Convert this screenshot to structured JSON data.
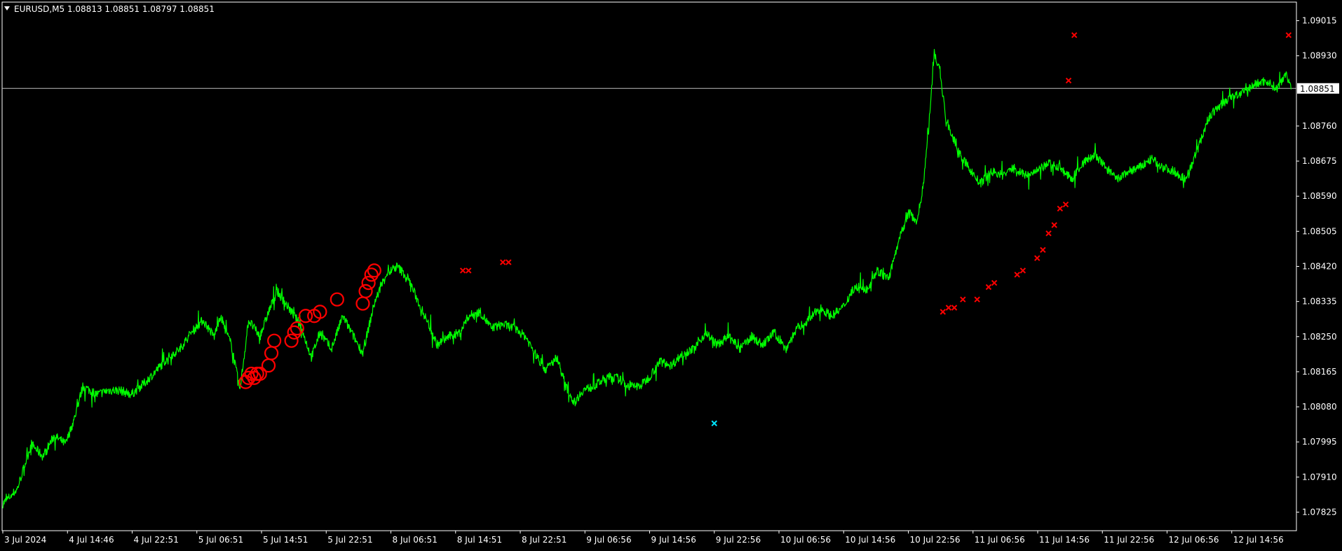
{
  "window": {
    "title": "EURUSD,M5  1.08813 1.08851 1.08797 1.08851",
    "menu_icon": "triangle-down-icon"
  },
  "colors": {
    "background": "#000000",
    "frame": "#ffffff",
    "price_line": "#00ff00",
    "marker_red": "#ff0000",
    "marker_cyan": "#00e5ff",
    "current_price_line": "#bebebe",
    "label_bg": "#ffffff",
    "label_text": "#000000"
  },
  "chart_data": {
    "type": "line",
    "symbol": "EURUSD",
    "timeframe": "M5",
    "ylim": [
      1.0778,
      1.0906
    ],
    "current_price": "1.08851",
    "price_ticks": [
      "1.09015",
      "1.08930",
      "1.08851",
      "1.08760",
      "1.08675",
      "1.08590",
      "1.08505",
      "1.08420",
      "1.08335",
      "1.08250",
      "1.08165",
      "1.08080",
      "1.07995",
      "1.07910",
      "1.07825"
    ],
    "time_ticks": [
      "3 Jul 2024",
      "4 Jul 14:46",
      "4 Jul 22:51",
      "5 Jul 06:51",
      "5 Jul 14:51",
      "5 Jul 22:51",
      "8 Jul 06:51",
      "8 Jul 14:51",
      "8 Jul 22:51",
      "9 Jul 06:56",
      "9 Jul 14:56",
      "9 Jul 22:56",
      "10 Jul 06:56",
      "10 Jul 14:56",
      "10 Jul 22:56",
      "11 Jul 06:56",
      "11 Jul 14:56",
      "11 Jul 22:56",
      "12 Jul 06:56",
      "12 Jul 14:56"
    ],
    "series": [
      {
        "values": [
          [
            0,
            1.07845
          ],
          [
            5,
            1.0788
          ],
          [
            10,
            1.0799
          ],
          [
            14,
            1.0796
          ],
          [
            18,
            1.0801
          ],
          [
            22,
            1.0799
          ],
          [
            25,
            1.0805
          ],
          [
            28,
            1.0813
          ],
          [
            33,
            1.0811
          ],
          [
            37,
            1.0812
          ],
          [
            41,
            1.0812
          ],
          [
            45,
            1.0811
          ],
          [
            50,
            1.0814
          ],
          [
            54,
            1.0817
          ],
          [
            58,
            1.082
          ],
          [
            62,
            1.0822
          ],
          [
            66,
            1.0826
          ],
          [
            70,
            1.0829
          ],
          [
            74,
            1.0825
          ],
          [
            76,
            1.083
          ],
          [
            80,
            1.0823
          ],
          [
            83,
            1.0812
          ],
          [
            86,
            1.0829
          ],
          [
            90,
            1.0825
          ],
          [
            93,
            1.0831
          ],
          [
            96,
            1.0836
          ],
          [
            100,
            1.0832
          ],
          [
            104,
            1.0828
          ],
          [
            108,
            1.082
          ],
          [
            111,
            1.0826
          ],
          [
            115,
            1.0822
          ],
          [
            119,
            1.083
          ],
          [
            122,
            1.0826
          ],
          [
            126,
            1.0821
          ],
          [
            130,
            1.0833
          ],
          [
            134,
            1.084
          ],
          [
            138,
            1.0842
          ],
          [
            142,
            1.0839
          ],
          [
            145,
            1.0834
          ],
          [
            149,
            1.0828
          ],
          [
            152,
            1.0823
          ],
          [
            156,
            1.0825
          ],
          [
            160,
            1.0826
          ],
          [
            163,
            1.083
          ],
          [
            167,
            1.0831
          ],
          [
            171,
            1.0827
          ],
          [
            175,
            1.0828
          ],
          [
            179,
            1.0827
          ],
          [
            183,
            1.0825
          ],
          [
            187,
            1.082
          ],
          [
            190,
            1.0817
          ],
          [
            194,
            1.082
          ],
          [
            197,
            1.0813
          ],
          [
            200,
            1.0809
          ],
          [
            203,
            1.0812
          ],
          [
            207,
            1.0813
          ],
          [
            211,
            1.0815
          ],
          [
            215,
            1.0815
          ],
          [
            219,
            1.0813
          ],
          [
            223,
            1.0813
          ],
          [
            226,
            1.0815
          ],
          [
            230,
            1.0819
          ],
          [
            234,
            1.0818
          ],
          [
            238,
            1.0821
          ],
          [
            242,
            1.0822
          ],
          [
            246,
            1.0826
          ],
          [
            250,
            1.0823
          ],
          [
            254,
            1.0825
          ],
          [
            258,
            1.0822
          ],
          [
            262,
            1.0825
          ],
          [
            266,
            1.0823
          ],
          [
            270,
            1.0826
          ],
          [
            274,
            1.0822
          ],
          [
            278,
            1.0827
          ],
          [
            282,
            1.0829
          ],
          [
            286,
            1.0832
          ],
          [
            290,
            1.083
          ],
          [
            294,
            1.0832
          ],
          [
            298,
            1.0837
          ],
          [
            302,
            1.0836
          ],
          [
            306,
            1.0841
          ],
          [
            310,
            1.0839
          ],
          [
            314,
            1.0849
          ],
          [
            317,
            1.0855
          ],
          [
            320,
            1.0853
          ],
          [
            322,
            1.0861
          ],
          [
            324,
            1.0875
          ],
          [
            326,
            1.0894
          ],
          [
            328,
            1.0889
          ],
          [
            330,
            1.0878
          ],
          [
            332,
            1.0874
          ],
          [
            335,
            1.0869
          ],
          [
            338,
            1.0866
          ],
          [
            342,
            1.0862
          ],
          [
            346,
            1.0865
          ],
          [
            350,
            1.0864
          ],
          [
            354,
            1.0866
          ],
          [
            358,
            1.0864
          ],
          [
            362,
            1.0865
          ],
          [
            366,
            1.0867
          ],
          [
            370,
            1.0866
          ],
          [
            374,
            1.0863
          ],
          [
            378,
            1.0867
          ],
          [
            382,
            1.0869
          ],
          [
            386,
            1.0866
          ],
          [
            390,
            1.0863
          ],
          [
            394,
            1.0865
          ],
          [
            398,
            1.0866
          ],
          [
            402,
            1.0868
          ],
          [
            406,
            1.0866
          ],
          [
            410,
            1.0865
          ],
          [
            414,
            1.0863
          ],
          [
            418,
            1.087
          ],
          [
            422,
            1.0878
          ],
          [
            426,
            1.0881
          ],
          [
            430,
            1.0883
          ],
          [
            434,
            1.0884
          ],
          [
            438,
            1.0886
          ],
          [
            442,
            1.0887
          ],
          [
            446,
            1.0885
          ],
          [
            449,
            1.0889
          ],
          [
            451,
            1.0885
          ]
        ]
      }
    ],
    "markers": [
      {
        "type": "circle",
        "color": "red",
        "points": [
          [
            85,
            1.0814
          ],
          [
            86,
            1.0815
          ],
          [
            87,
            1.0816
          ],
          [
            88,
            1.0815
          ],
          [
            89,
            1.0816
          ],
          [
            90,
            1.0816
          ],
          [
            93,
            1.0818
          ],
          [
            94,
            1.0821
          ],
          [
            95,
            1.0824
          ],
          [
            101,
            1.0824
          ],
          [
            102,
            1.0826
          ],
          [
            103,
            1.0827
          ],
          [
            106,
            1.083
          ],
          [
            109,
            1.083
          ],
          [
            111,
            1.0831
          ],
          [
            117,
            1.0834
          ],
          [
            126,
            1.0833
          ],
          [
            127,
            1.0836
          ],
          [
            128,
            1.0838
          ],
          [
            129,
            1.084
          ],
          [
            130,
            1.0841
          ]
        ]
      },
      {
        "type": "x",
        "color": "red",
        "points": [
          [
            161,
            1.0841
          ],
          [
            163,
            1.0841
          ],
          [
            175,
            1.0843
          ],
          [
            177,
            1.0843
          ],
          [
            329,
            1.0831
          ],
          [
            331,
            1.0832
          ],
          [
            333,
            1.0832
          ],
          [
            336,
            1.0834
          ],
          [
            341,
            1.0834
          ],
          [
            345,
            1.0837
          ],
          [
            347,
            1.0838
          ],
          [
            355,
            1.084
          ],
          [
            357,
            1.0841
          ],
          [
            362,
            1.0844
          ],
          [
            364,
            1.0846
          ],
          [
            366,
            1.085
          ],
          [
            368,
            1.0852
          ],
          [
            370,
            1.0856
          ],
          [
            372,
            1.0857
          ],
          [
            373,
            1.0887
          ],
          [
            375,
            1.0898
          ],
          [
            450,
            1.0898
          ]
        ]
      },
      {
        "type": "x",
        "color": "cyan",
        "points": [
          [
            249,
            1.0804
          ]
        ]
      }
    ]
  }
}
